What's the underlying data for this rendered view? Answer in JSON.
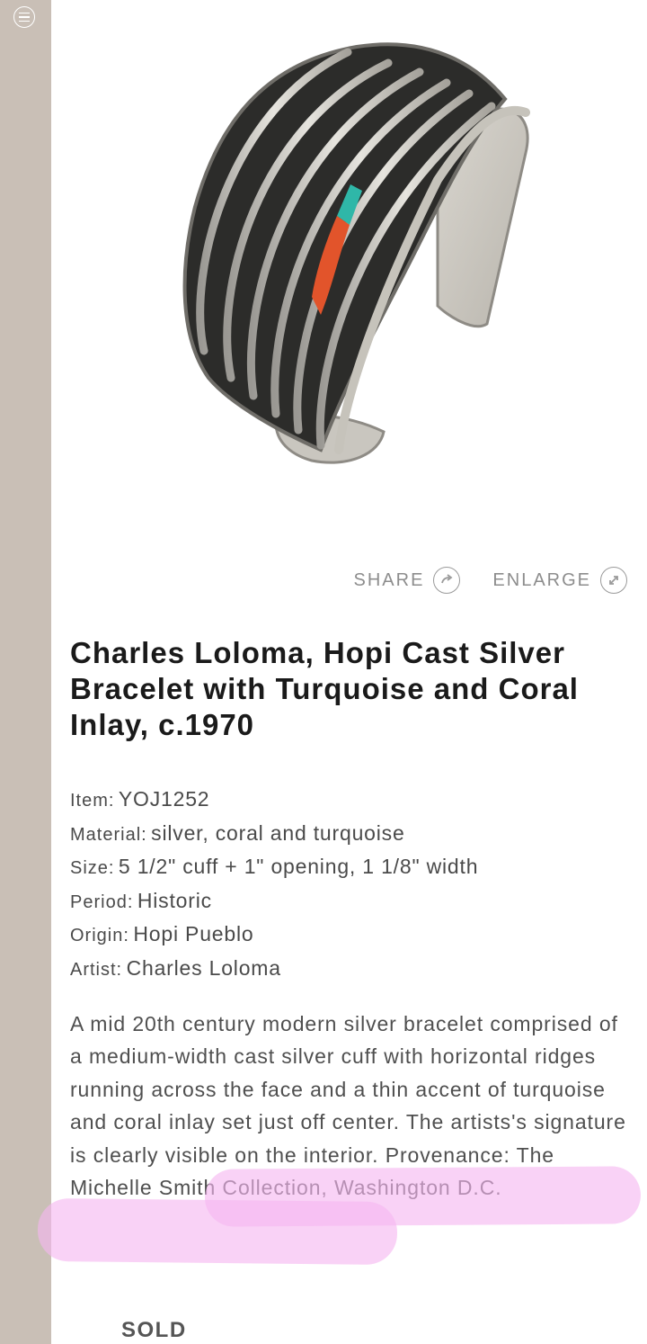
{
  "nav": {
    "menu_icon": "hamburger-menu-icon"
  },
  "image": {
    "subject": "bracelet-photo"
  },
  "actions": {
    "share_label": "SHARE",
    "share_icon": "share-arrow-icon",
    "enlarge_label": "ENLARGE",
    "enlarge_icon": "expand-icon"
  },
  "product": {
    "title": "Charles Loloma, Hopi Cast Silver Bracelet with Turquoise and Coral Inlay, c.1970",
    "specs": [
      {
        "label": "Item:",
        "value": "YOJ1252"
      },
      {
        "label": "Material:",
        "value": "silver, coral and turquoise"
      },
      {
        "label": "Size:",
        "value": "5 1/2\" cuff + 1\" opening, 1 1/8\" width"
      },
      {
        "label": "Period:",
        "value": "Historic"
      },
      {
        "label": "Origin:",
        "value": "Hopi Pueblo"
      },
      {
        "label": "Artist:",
        "value": "Charles Loloma"
      }
    ],
    "description": "A mid 20th century modern silver bracelet comprised of a medium-width cast silver cuff with horizontal ridges running across the face and a thin accent of turquoise and coral inlay set just off center. The artists's signature is clearly visible on the interior. Provenance: The Michelle Smith Collection, Washington D.C.",
    "status": "SOLD"
  },
  "colors": {
    "sidebar": "#c9bfb6",
    "highlight": "#f6b6f0",
    "turquoise": "#2fb7a8",
    "coral": "#e2542b"
  }
}
